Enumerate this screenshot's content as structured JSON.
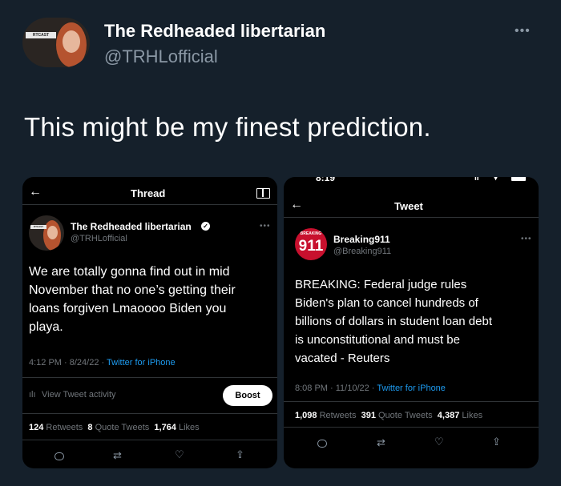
{
  "main": {
    "author_name": "The Redheaded libertarian",
    "author_handle": "@TRHLofficial",
    "text": "This might be my finest prediction.",
    "avatar_tag": "RTCAST"
  },
  "left_screenshot": {
    "header_title": "Thread",
    "author_name": "The Redheaded libertarian",
    "author_handle": "@TRHLofficial",
    "tweet_lines": [
      "We are totally gonna find out in mid",
      "November that no one’s getting their",
      "loans forgiven Lmaoooo Biden you",
      "playa."
    ],
    "timestamp": "4:12 PM · 8/24/22 · ",
    "source": "Twitter for iPhone",
    "activity_label": "View Tweet activity",
    "boost_label": "Boost",
    "stats": {
      "retweets_count": "124",
      "retweets_label": "Retweets",
      "quotes_count": "8",
      "quotes_label": "Quote Tweets",
      "likes_count": "1,764",
      "likes_label": "Likes"
    },
    "avatar_tag": "RTCAST"
  },
  "right_screenshot": {
    "status_time": "8:19",
    "header_title": "Tweet",
    "author_name": "Breaking911",
    "author_handle": "@Breaking911",
    "avatar_text": "BREAKING",
    "avatar_number": "911",
    "tweet_lines": [
      "BREAKING: Federal judge rules",
      "Biden's plan to cancel hundreds of",
      "billions of dollars in student loan debt",
      "is unconstitutional and must be",
      "vacated - Reuters"
    ],
    "timestamp": "8:08 PM · 11/10/22 · ",
    "source": "Twitter for iPhone",
    "stats": {
      "retweets_count": "1,098",
      "retweets_label": "Retweets",
      "quotes_count": "391",
      "quotes_label": "Quote Tweets",
      "likes_count": "4,387",
      "likes_label": "Likes"
    }
  },
  "icons": [
    "back-arrow-icon",
    "reader-icon",
    "more-icon",
    "verified-icon",
    "analytics-icon",
    "reply-icon",
    "retweet-icon",
    "like-icon",
    "share-icon"
  ],
  "colors": {
    "background": "#15202b",
    "link": "#1d9bf0",
    "muted": "#8b98a5",
    "breaking_red": "#c8102e"
  }
}
